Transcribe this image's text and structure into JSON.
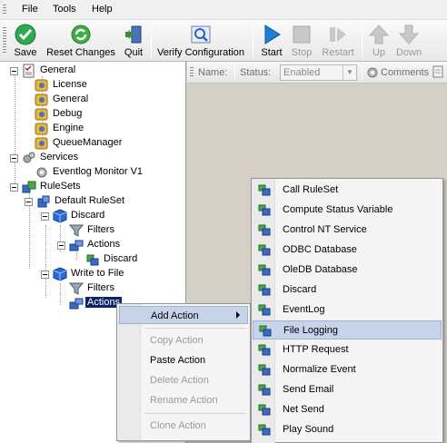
{
  "menu": {
    "file": "File",
    "tools": "Tools",
    "help": "Help"
  },
  "toolbar": {
    "save": "Save",
    "reset": "Reset Changes",
    "quit": "Quit",
    "verify": "Verify Configuration",
    "start": "Start",
    "stop": "Stop",
    "restart": "Restart",
    "up": "Up",
    "down": "Down"
  },
  "colors": {
    "selection": "#0a246a",
    "menu_hover": "#c6d3e9",
    "start_blue": "#1e7fd8",
    "save_green": "#2fa84f"
  },
  "tree": {
    "general": "General",
    "license": "License",
    "general_child": "General",
    "debug": "Debug",
    "engine": "Engine",
    "queue_manager": "QueueManager",
    "services": "Services",
    "eventlog_monitor": "Eventlog Monitor V1",
    "rulesets": "RuleSets",
    "default_ruleset": "Default RuleSet",
    "discard": "Discard",
    "discard_filters": "Filters",
    "discard_actions": "Actions",
    "discard_action": "Discard",
    "write_to_file": "Write to File",
    "wtf_filters": "Filters",
    "wtf_actions": "Actions"
  },
  "details": {
    "name_label": "Name:",
    "status_label": "Status:",
    "status_value": "Enabled",
    "comments": "Comments"
  },
  "context_menu": {
    "add_action": "Add Action",
    "copy_action": "Copy Action",
    "paste_action": "Paste Action",
    "delete_action": "Delete Action",
    "rename_action": "Rename Action",
    "clone_action": "Clone Action"
  },
  "submenu": {
    "items": [
      "Call RuleSet",
      "Compute Status Variable",
      "Control NT Service",
      "ODBC Database",
      "OleDB Database",
      "Discard",
      "EventLog",
      "File Logging",
      "HTTP Request",
      "Normalize Event",
      "Send Email",
      "Net Send",
      "Play Sound"
    ],
    "highlighted_index": 7
  }
}
